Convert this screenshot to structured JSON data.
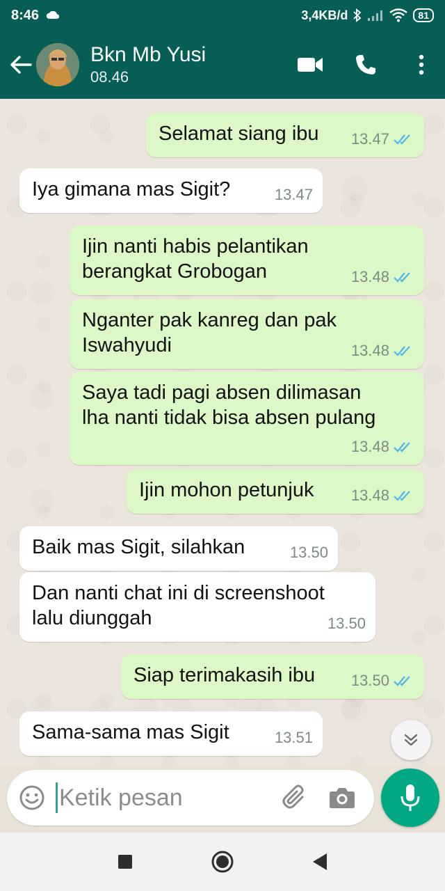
{
  "status_bar": {
    "time": "8:46",
    "net_speed": "3,4KB/d",
    "battery": "81"
  },
  "header": {
    "contact_name": "Bkn Mb Yusi",
    "subtitle": "08.46"
  },
  "messages": [
    {
      "dir": "out",
      "text": "Selamat siang ibu",
      "time": "13.47",
      "read": true
    },
    {
      "dir": "in",
      "text": "Iya gimana mas Sigit?",
      "time": "13.47"
    },
    {
      "dir": "out",
      "text": "Ijin nanti habis pelantikan\nberangkat Grobogan",
      "time": "13.48",
      "read": true
    },
    {
      "dir": "out",
      "text": "Nganter pak kanreg dan pak\nIswahyudi",
      "time": "13.48",
      "read": true
    },
    {
      "dir": "out",
      "text": "Saya tadi pagi absen dilimasan\nlha nanti tidak bisa absen pulang",
      "time": "13.48",
      "read": true
    },
    {
      "dir": "out",
      "text": "Ijin mohon petunjuk",
      "time": "13.48",
      "read": true
    },
    {
      "dir": "in",
      "text": "Baik mas Sigit, silahkan",
      "time": "13.50"
    },
    {
      "dir": "in",
      "text": "Dan nanti chat ini di screenshoot\nlalu diunggah",
      "time": "13.50"
    },
    {
      "dir": "out",
      "text": "Siap terimakasih ibu",
      "time": "13.50",
      "read": true
    },
    {
      "dir": "in",
      "text": "Sama-sama mas Sigit",
      "time": "13.51"
    }
  ],
  "composer": {
    "placeholder": "Ketik pesan"
  },
  "colors": {
    "header": "#075e54",
    "outgoing": "#dcf8c6",
    "incoming": "#ffffff",
    "accent": "#00a884",
    "read_ticks": "#4fb6ec"
  },
  "icons": [
    "back-arrow-icon",
    "video-call-icon",
    "phone-icon",
    "more-vert-icon",
    "emoji-icon",
    "attach-icon",
    "camera-icon",
    "mic-icon",
    "chevron-double-down-icon"
  ]
}
